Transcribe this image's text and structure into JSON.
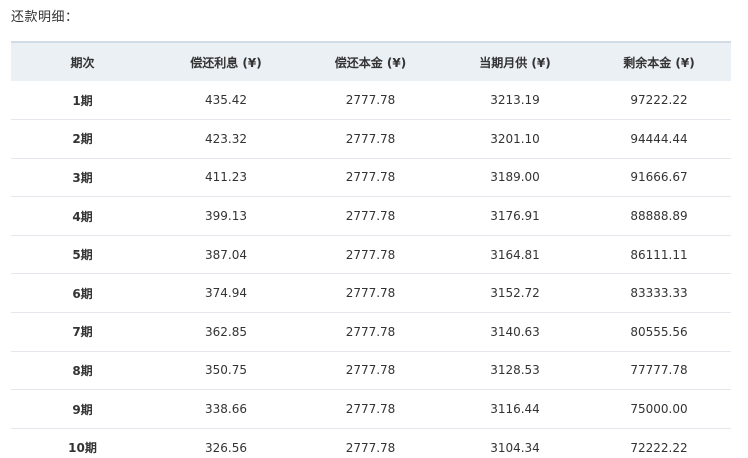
{
  "section": {
    "title": "还款明细："
  },
  "table": {
    "headers": [
      "期次",
      "偿还利息 (¥)",
      "偿还本金 (¥)",
      "当期月供 (¥)",
      "剩余本金 (¥)"
    ],
    "rows": [
      [
        "1期",
        "435.42",
        "2777.78",
        "3213.19",
        "97222.22"
      ],
      [
        "2期",
        "423.32",
        "2777.78",
        "3201.10",
        "94444.44"
      ],
      [
        "3期",
        "411.23",
        "2777.78",
        "3189.00",
        "91666.67"
      ],
      [
        "4期",
        "399.13",
        "2777.78",
        "3176.91",
        "88888.89"
      ],
      [
        "5期",
        "387.04",
        "2777.78",
        "3164.81",
        "86111.11"
      ],
      [
        "6期",
        "374.94",
        "2777.78",
        "3152.72",
        "83333.33"
      ],
      [
        "7期",
        "362.85",
        "2777.78",
        "3140.63",
        "80555.56"
      ],
      [
        "8期",
        "350.75",
        "2777.78",
        "3128.53",
        "77777.78"
      ],
      [
        "9期",
        "338.66",
        "2777.78",
        "3116.44",
        "75000.00"
      ],
      [
        "10期",
        "326.56",
        "2777.78",
        "3104.34",
        "72222.22"
      ]
    ]
  },
  "colors": {
    "header_bg": "#ebf0f5",
    "header_border": "#d2dce6",
    "row_divider": "#e4e8ed",
    "text": "#333333"
  }
}
